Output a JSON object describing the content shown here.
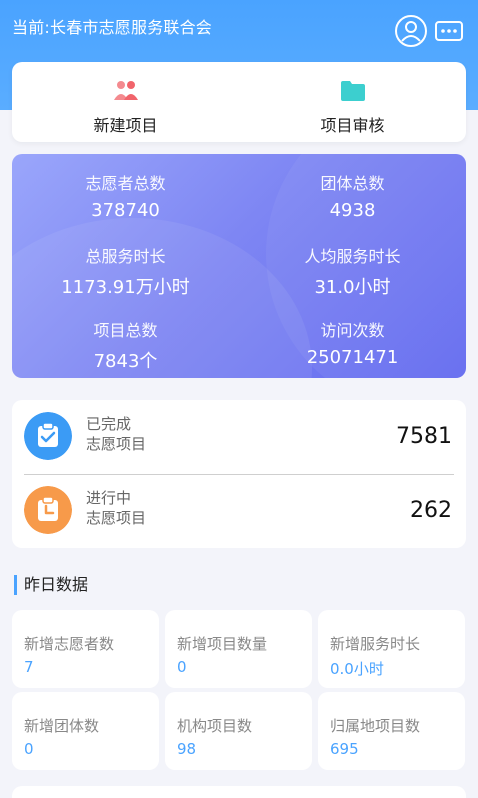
{
  "header": {
    "title": "当前:长春市志愿服务联合会"
  },
  "quick_actions": [
    {
      "label": "新建项目",
      "icon": "users-icon",
      "color": "#f1646b"
    },
    {
      "label": "项目审核",
      "icon": "folder-icon",
      "color": "#3ccfcf"
    }
  ],
  "stats": [
    {
      "label": "志愿者总数",
      "value": "378740"
    },
    {
      "label": "团体总数",
      "value": "4938"
    },
    {
      "label": "总服务时长",
      "value": "1173.91万小时"
    },
    {
      "label": "人均服务时长",
      "value": "31.0小时"
    },
    {
      "label": "项目总数",
      "value": "7843个"
    },
    {
      "label": "访问次数",
      "value": "25071471"
    }
  ],
  "projects": {
    "completed": {
      "line1": "已完成",
      "line2": "志愿项目",
      "value": "7581",
      "color": "#3b9bf5"
    },
    "ongoing": {
      "line1": "进行中",
      "line2": "志愿项目",
      "value": "262",
      "color": "#f79a4a"
    }
  },
  "yesterday": {
    "title": "昨日数据",
    "items": [
      {
        "label": "新增志愿者数",
        "value": "7"
      },
      {
        "label": "新增项目数量",
        "value": "0"
      },
      {
        "label": "新增服务时长",
        "value": "0.0小时"
      },
      {
        "label": "新增团体数",
        "value": "0"
      },
      {
        "label": "机构项目数",
        "value": "98"
      },
      {
        "label": "归属地项目数",
        "value": "695"
      }
    ]
  },
  "colors": {
    "brand_blue": "#4aa3ff",
    "stats_gradient_start": "#9aa6fb",
    "stats_gradient_end": "#636af0"
  }
}
